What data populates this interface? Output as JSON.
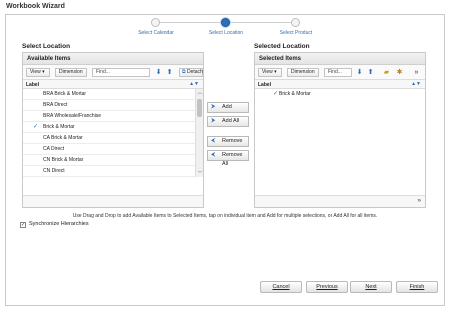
{
  "window": {
    "title": "Workbook Wizard"
  },
  "train": {
    "steps": [
      {
        "label": "Select Calendar",
        "state": "visited"
      },
      {
        "label": "Select Location",
        "state": "current"
      },
      {
        "label": "Select Product",
        "state": "unvisited"
      }
    ]
  },
  "left": {
    "section_title": "Select Location",
    "panel_title": "Available Items",
    "toolbar": {
      "view_label": "View",
      "dimension_label": "Dimension",
      "find_placeholder": "Find...",
      "detach_label": "Detach"
    },
    "column_header": "Label",
    "rows": [
      {
        "label": "BRA Brick & Mortar",
        "checked": false
      },
      {
        "label": "BRA Direct",
        "checked": false
      },
      {
        "label": "BRA Wholesale/Franchise",
        "checked": false
      },
      {
        "label": "Brick & Mortar",
        "checked": true
      },
      {
        "label": "CA Brick & Mortar",
        "checked": false
      },
      {
        "label": "CA Direct",
        "checked": false
      },
      {
        "label": "CN Brick & Mortar",
        "checked": false
      },
      {
        "label": "CN Direct",
        "checked": false
      }
    ]
  },
  "shuttle": {
    "add": "Add",
    "add_all": "Add All",
    "remove": "Remove",
    "remove_all": "Remove All"
  },
  "right": {
    "section_title": "Selected Location",
    "panel_title": "Selected Items",
    "toolbar": {
      "view_label": "View",
      "dimension_label": "Dimension",
      "find_placeholder": "Find..."
    },
    "column_header": "Label",
    "rows": [
      {
        "label": "Brick & Mortar",
        "checked": true
      }
    ]
  },
  "hint_text": "Use Drag and Drop to add Available Items to Selected Items, tap on individual item and Add for multiple selections, or Add All for all items.",
  "sync": {
    "label": "Synchronize Hierarchies",
    "checked": true
  },
  "buttons": {
    "cancel": "Cancel",
    "previous": "Previous",
    "next": "Next",
    "finish": "Finish"
  },
  "colors": {
    "accent": "#2b6fb6",
    "border": "#c9c9c9"
  }
}
